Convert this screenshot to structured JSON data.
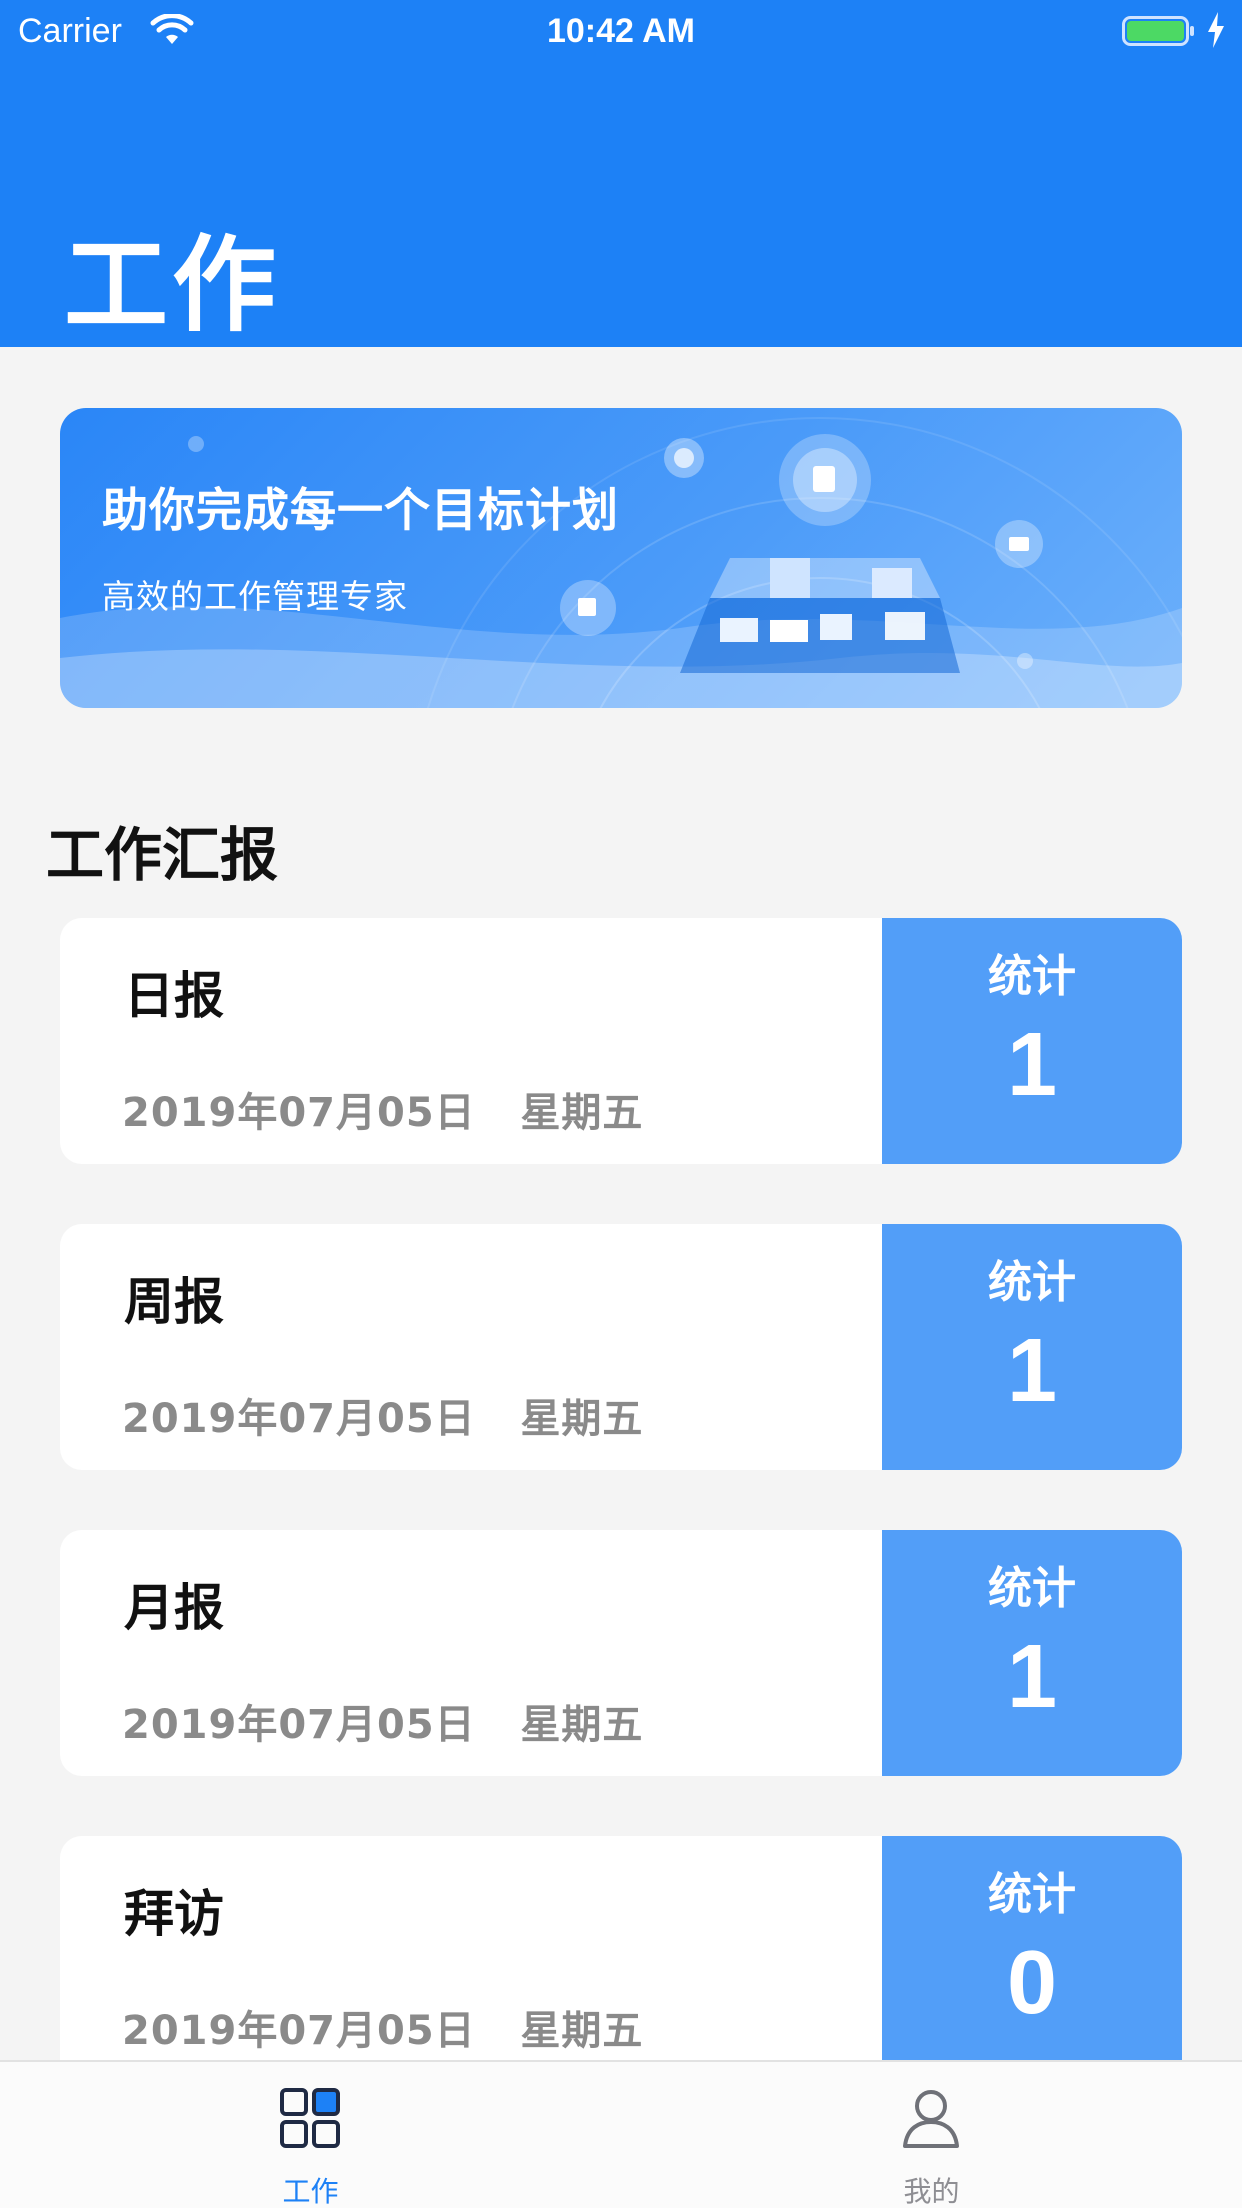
{
  "status_bar": {
    "carrier": "Carrier",
    "time": "10:42 AM"
  },
  "header": {
    "title": "工作",
    "color": "#1d81f6"
  },
  "banner": {
    "headline": "助你完成每一个目标计划",
    "subtitle": "高效的工作管理专家"
  },
  "section": {
    "title": "工作汇报"
  },
  "reports": [
    {
      "name": "日报",
      "date": "2019年07月05日",
      "weekday": "星期五",
      "stat_label": "统计",
      "stat_value": "1"
    },
    {
      "name": "周报",
      "date": "2019年07月05日",
      "weekday": "星期五",
      "stat_label": "统计",
      "stat_value": "1"
    },
    {
      "name": "月报",
      "date": "2019年07月05日",
      "weekday": "星期五",
      "stat_label": "统计",
      "stat_value": "1"
    },
    {
      "name": "拜访",
      "date": "2019年07月05日",
      "weekday": "星期五",
      "stat_label": "统计",
      "stat_value": "0"
    }
  ],
  "tab_bar": {
    "tabs": [
      {
        "label": "工作",
        "icon": "grid-icon",
        "active": true,
        "color": "#1d81f6"
      },
      {
        "label": "我的",
        "icon": "person-icon",
        "active": false,
        "color": "#8e8e93"
      }
    ]
  }
}
